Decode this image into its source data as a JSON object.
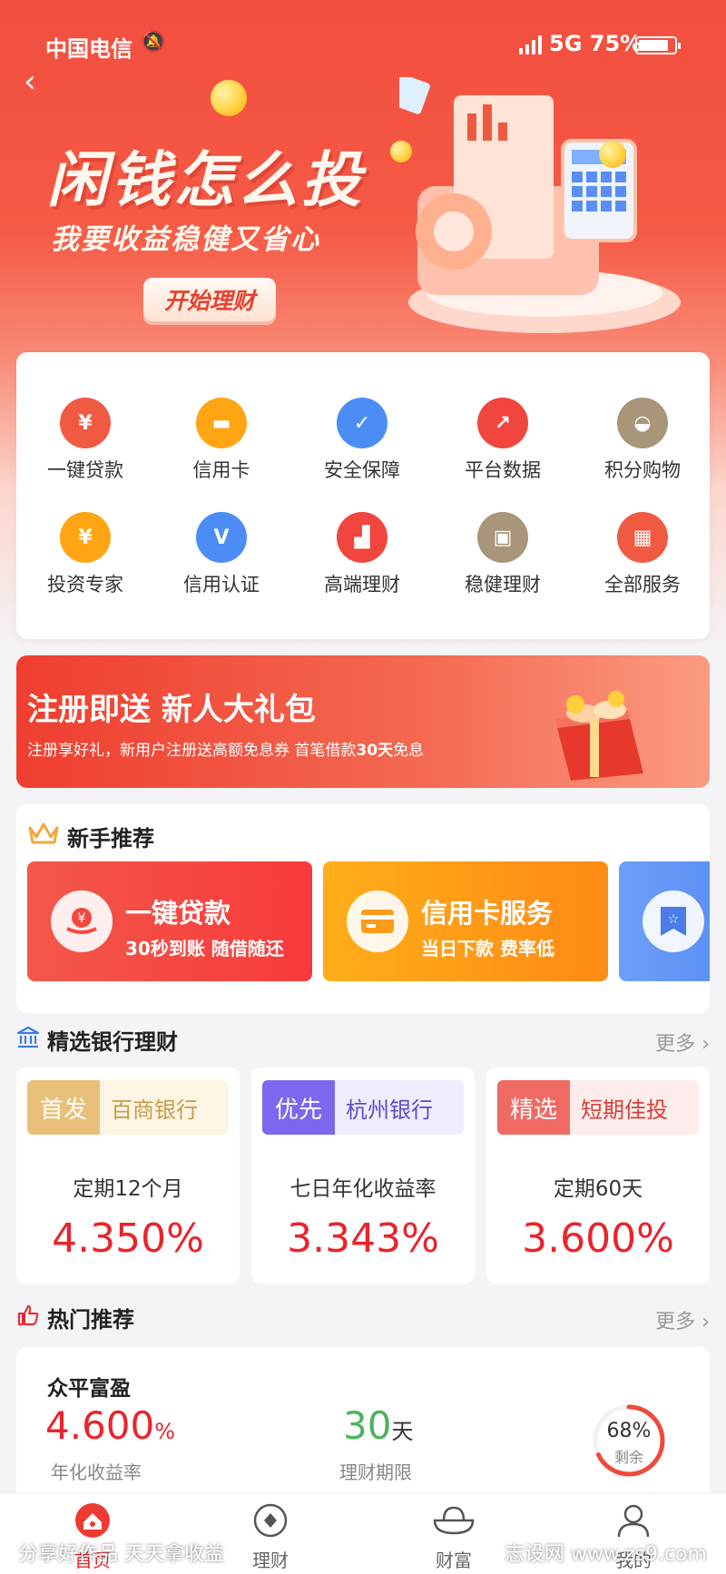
{
  "status_bar": {
    "carrier": "中国电信",
    "network": "5G",
    "battery": "75%",
    "battery_level": 0.75
  },
  "hero": {
    "title": "闲钱怎么投",
    "subtitle": "我要收益稳健又省心",
    "cta": "开始理财"
  },
  "services": [
    {
      "label": "一键贷款",
      "icon": "money-bag-icon",
      "color": "#f05a43",
      "glyph": "¥"
    },
    {
      "label": "信用卡",
      "icon": "credit-card-icon",
      "color": "#ffa514",
      "glyph": "▬"
    },
    {
      "label": "安全保障",
      "icon": "shield-check-icon",
      "color": "#4b8df5",
      "glyph": "✓"
    },
    {
      "label": "平台数据",
      "icon": "chart-icon",
      "color": "#f0463e",
      "glyph": "↗"
    },
    {
      "label": "积分购物",
      "icon": "shopping-bag-icon",
      "color": "#a8957a",
      "glyph": "◒"
    },
    {
      "label": "投资专家",
      "icon": "hexagon-yen-icon",
      "color": "#ffa514",
      "glyph": "¥"
    },
    {
      "label": "信用认证",
      "icon": "shield-v-icon",
      "color": "#4b8df5",
      "glyph": "V"
    },
    {
      "label": "高端理财",
      "icon": "bar-chart-icon",
      "color": "#f0463e",
      "glyph": "▟"
    },
    {
      "label": "稳健理财",
      "icon": "wallet-icon",
      "color": "#a8957a",
      "glyph": "▣"
    },
    {
      "label": "全部服务",
      "icon": "grid-icon",
      "color": "#f05a43",
      "glyph": "▦"
    }
  ],
  "promo": {
    "title": "注册即送 新人大礼包",
    "subtitle_prefix": "注册享好礼，新用户注册送高额免息券 首笔借款",
    "subtitle_bold": "30天",
    "subtitle_suffix": "免息"
  },
  "newbie": {
    "title": "新手推荐",
    "cards": [
      {
        "title": "一键贷款",
        "subtitle": "30秒到账 随借随还",
        "icon": "yen-hand-icon"
      },
      {
        "title": "信用卡服务",
        "subtitle": "当日下款 费率低",
        "icon": "credit-card-icon"
      },
      {
        "title": "",
        "subtitle": "",
        "icon": "star-badge-icon"
      }
    ]
  },
  "bank_section": {
    "title": "精选银行理财",
    "more": "更多",
    "items": [
      {
        "tag": "首发",
        "bank": "百商银行",
        "term": "定期12个月",
        "rate": "4.350%",
        "tag_color": "#e8c07a",
        "tag_bg": "#fdf5e4",
        "tag_text": "#c89a4a"
      },
      {
        "tag": "优先",
        "bank": "杭州银行",
        "term": "七日年化收益率",
        "rate": "3.343%",
        "tag_color": "#7b68ee",
        "tag_bg": "#eeecfd",
        "tag_text": "#5b4ccc"
      },
      {
        "tag": "精选",
        "bank": "短期佳投",
        "term": "定期60天",
        "rate": "3.600%",
        "tag_color": "#ee6a63",
        "tag_bg": "#fdeceb",
        "tag_text": "#d8403a"
      }
    ]
  },
  "hot_section": {
    "title": "热门推荐",
    "more": "更多",
    "product": {
      "name": "众平富盈",
      "rate": "4.600",
      "rate_unit": "%",
      "rate_label": "年化收益率",
      "days": "30",
      "days_unit": "天",
      "days_label": "理财期限",
      "remaining": "68%",
      "remaining_label": "剩余",
      "remaining_value": 0.68
    }
  },
  "tabs": [
    {
      "label": "首页",
      "icon": "home-icon",
      "active": true
    },
    {
      "label": "理财",
      "icon": "diamond-icon",
      "active": false
    },
    {
      "label": "财富",
      "icon": "ingot-icon",
      "active": false
    },
    {
      "label": "我的",
      "icon": "user-icon",
      "active": false
    }
  ],
  "watermark": {
    "left": "分享好作品 天天拿收益",
    "right": "志设网 www.zs9.com"
  }
}
